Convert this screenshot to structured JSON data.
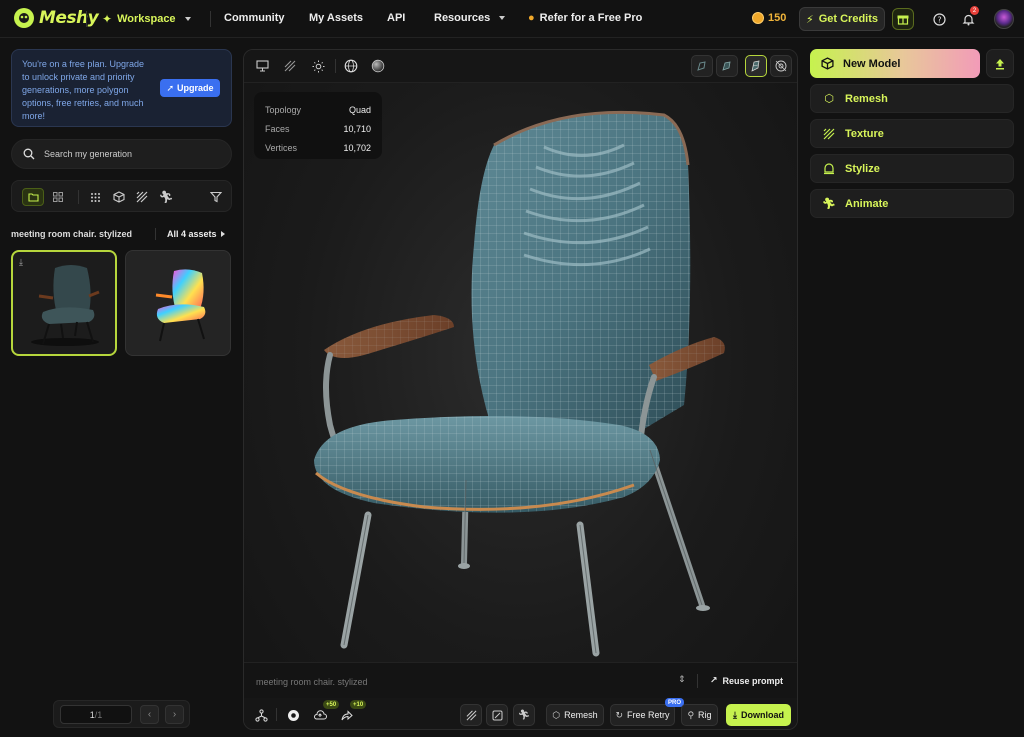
{
  "brand": {
    "name": "Meshy"
  },
  "nav": {
    "workspace": "Workspace",
    "community": "Community",
    "my_assets": "My Assets",
    "api": "API",
    "resources": "Resources",
    "refer": "Refer for a Free Pro"
  },
  "header": {
    "credits": "150",
    "get_credits": "Get Credits",
    "notifications": "2"
  },
  "promo": {
    "text": "You're on a free plan. Upgrade to unlock private and priority generations, more polygon options, free retries, and much more!",
    "upgrade": "Upgrade"
  },
  "search": {
    "placeholder": "Search my generation"
  },
  "list": {
    "title": "meeting room chair. stylized",
    "count": "All 4 assets"
  },
  "pager": {
    "current": "1",
    "total": "/1"
  },
  "viewer": {
    "stats": [
      {
        "label": "Topology",
        "value": "Quad"
      },
      {
        "label": "Faces",
        "value": "10,710"
      },
      {
        "label": "Vertices",
        "value": "10,702"
      }
    ],
    "prompt": "meeting room chair. stylized",
    "reuse": "Reuse prompt",
    "badge_a": "+50",
    "badge_b": "+10",
    "remesh": "Remesh",
    "free_retry": "Free Retry",
    "pro": "PRO",
    "rig": "Rig",
    "download": "Download"
  },
  "panel": {
    "new_model": "New Model",
    "remesh": "Remesh",
    "texture": "Texture",
    "stylize": "Stylize",
    "animate": "Animate"
  },
  "colors": {
    "accent": "#c6f24e",
    "upgrade_blue": "#3a6ff0",
    "coin": "#f0a82a"
  }
}
